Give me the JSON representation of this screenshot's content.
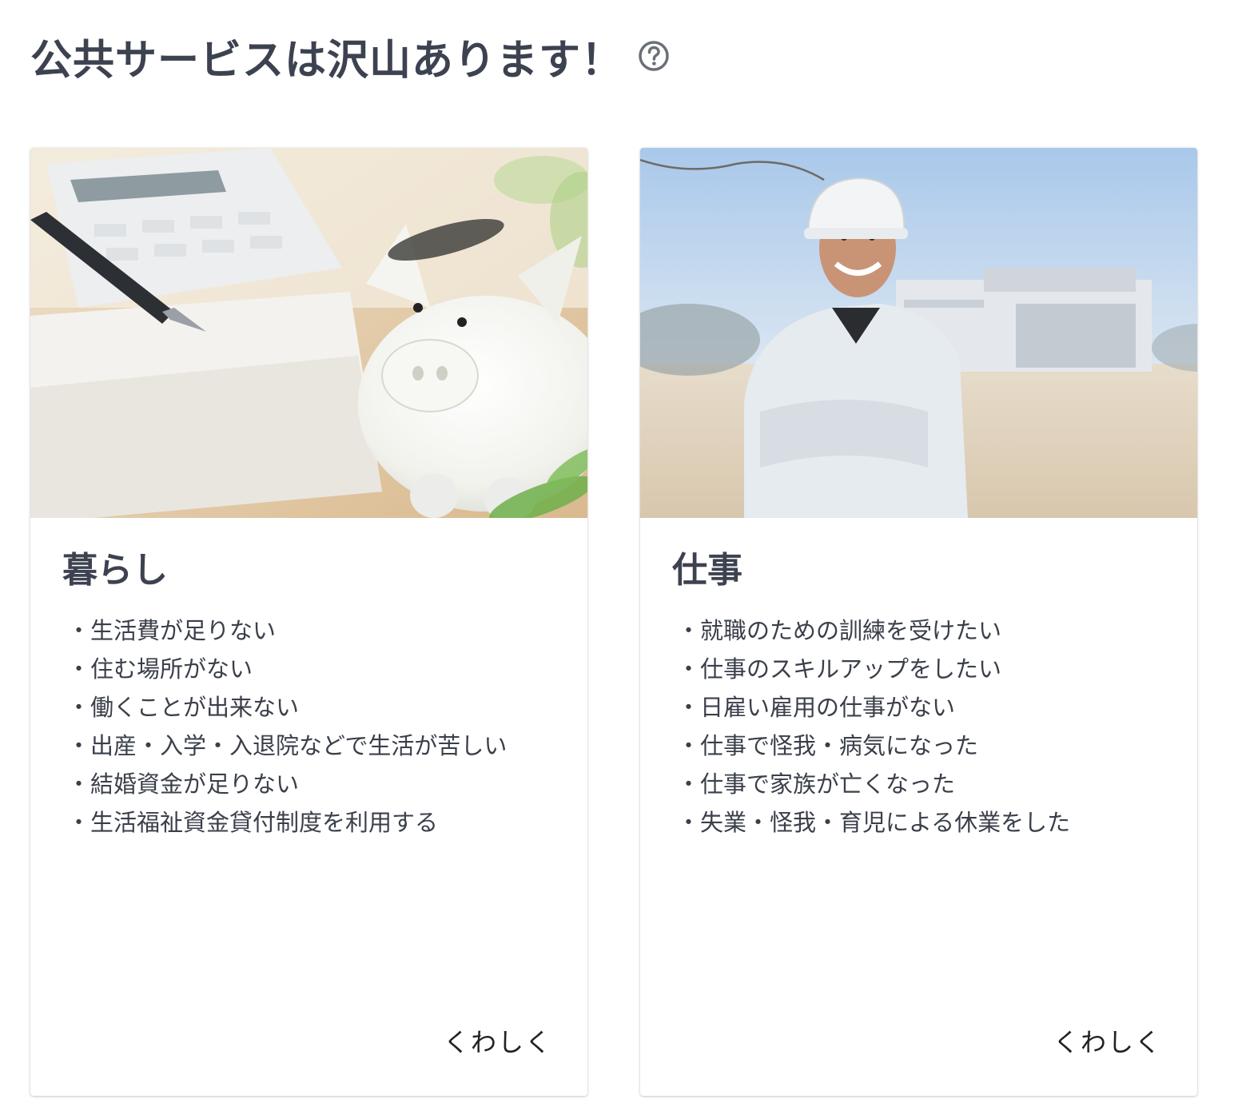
{
  "header": {
    "title": "公共サービスは沢山あります！",
    "help_icon": "question-circle-icon"
  },
  "cards": [
    {
      "title": "暮らし",
      "image": "piggy-bank-photo",
      "items": [
        "生活費が足りない",
        "住む場所がない",
        "働くことが出来ない",
        "出産・入学・入退院などで生活が苦しい",
        "結婚資金が足りない",
        "生活福祉資金貸付制度を利用する"
      ],
      "link_label": "くわしく"
    },
    {
      "title": "仕事",
      "image": "worker-photo",
      "items": [
        "就職のための訓練を受けたい",
        "仕事のスキルアップをしたい",
        "日雇い雇用の仕事がない",
        "仕事で怪我・病気になった",
        "仕事で家族が亡くなった",
        "失業・怪我・育児による休業をした"
      ],
      "link_label": "くわしく"
    }
  ],
  "colors": {
    "heading": "#3d4250",
    "text": "#3a3f4a",
    "icon": "#6b6f78"
  }
}
